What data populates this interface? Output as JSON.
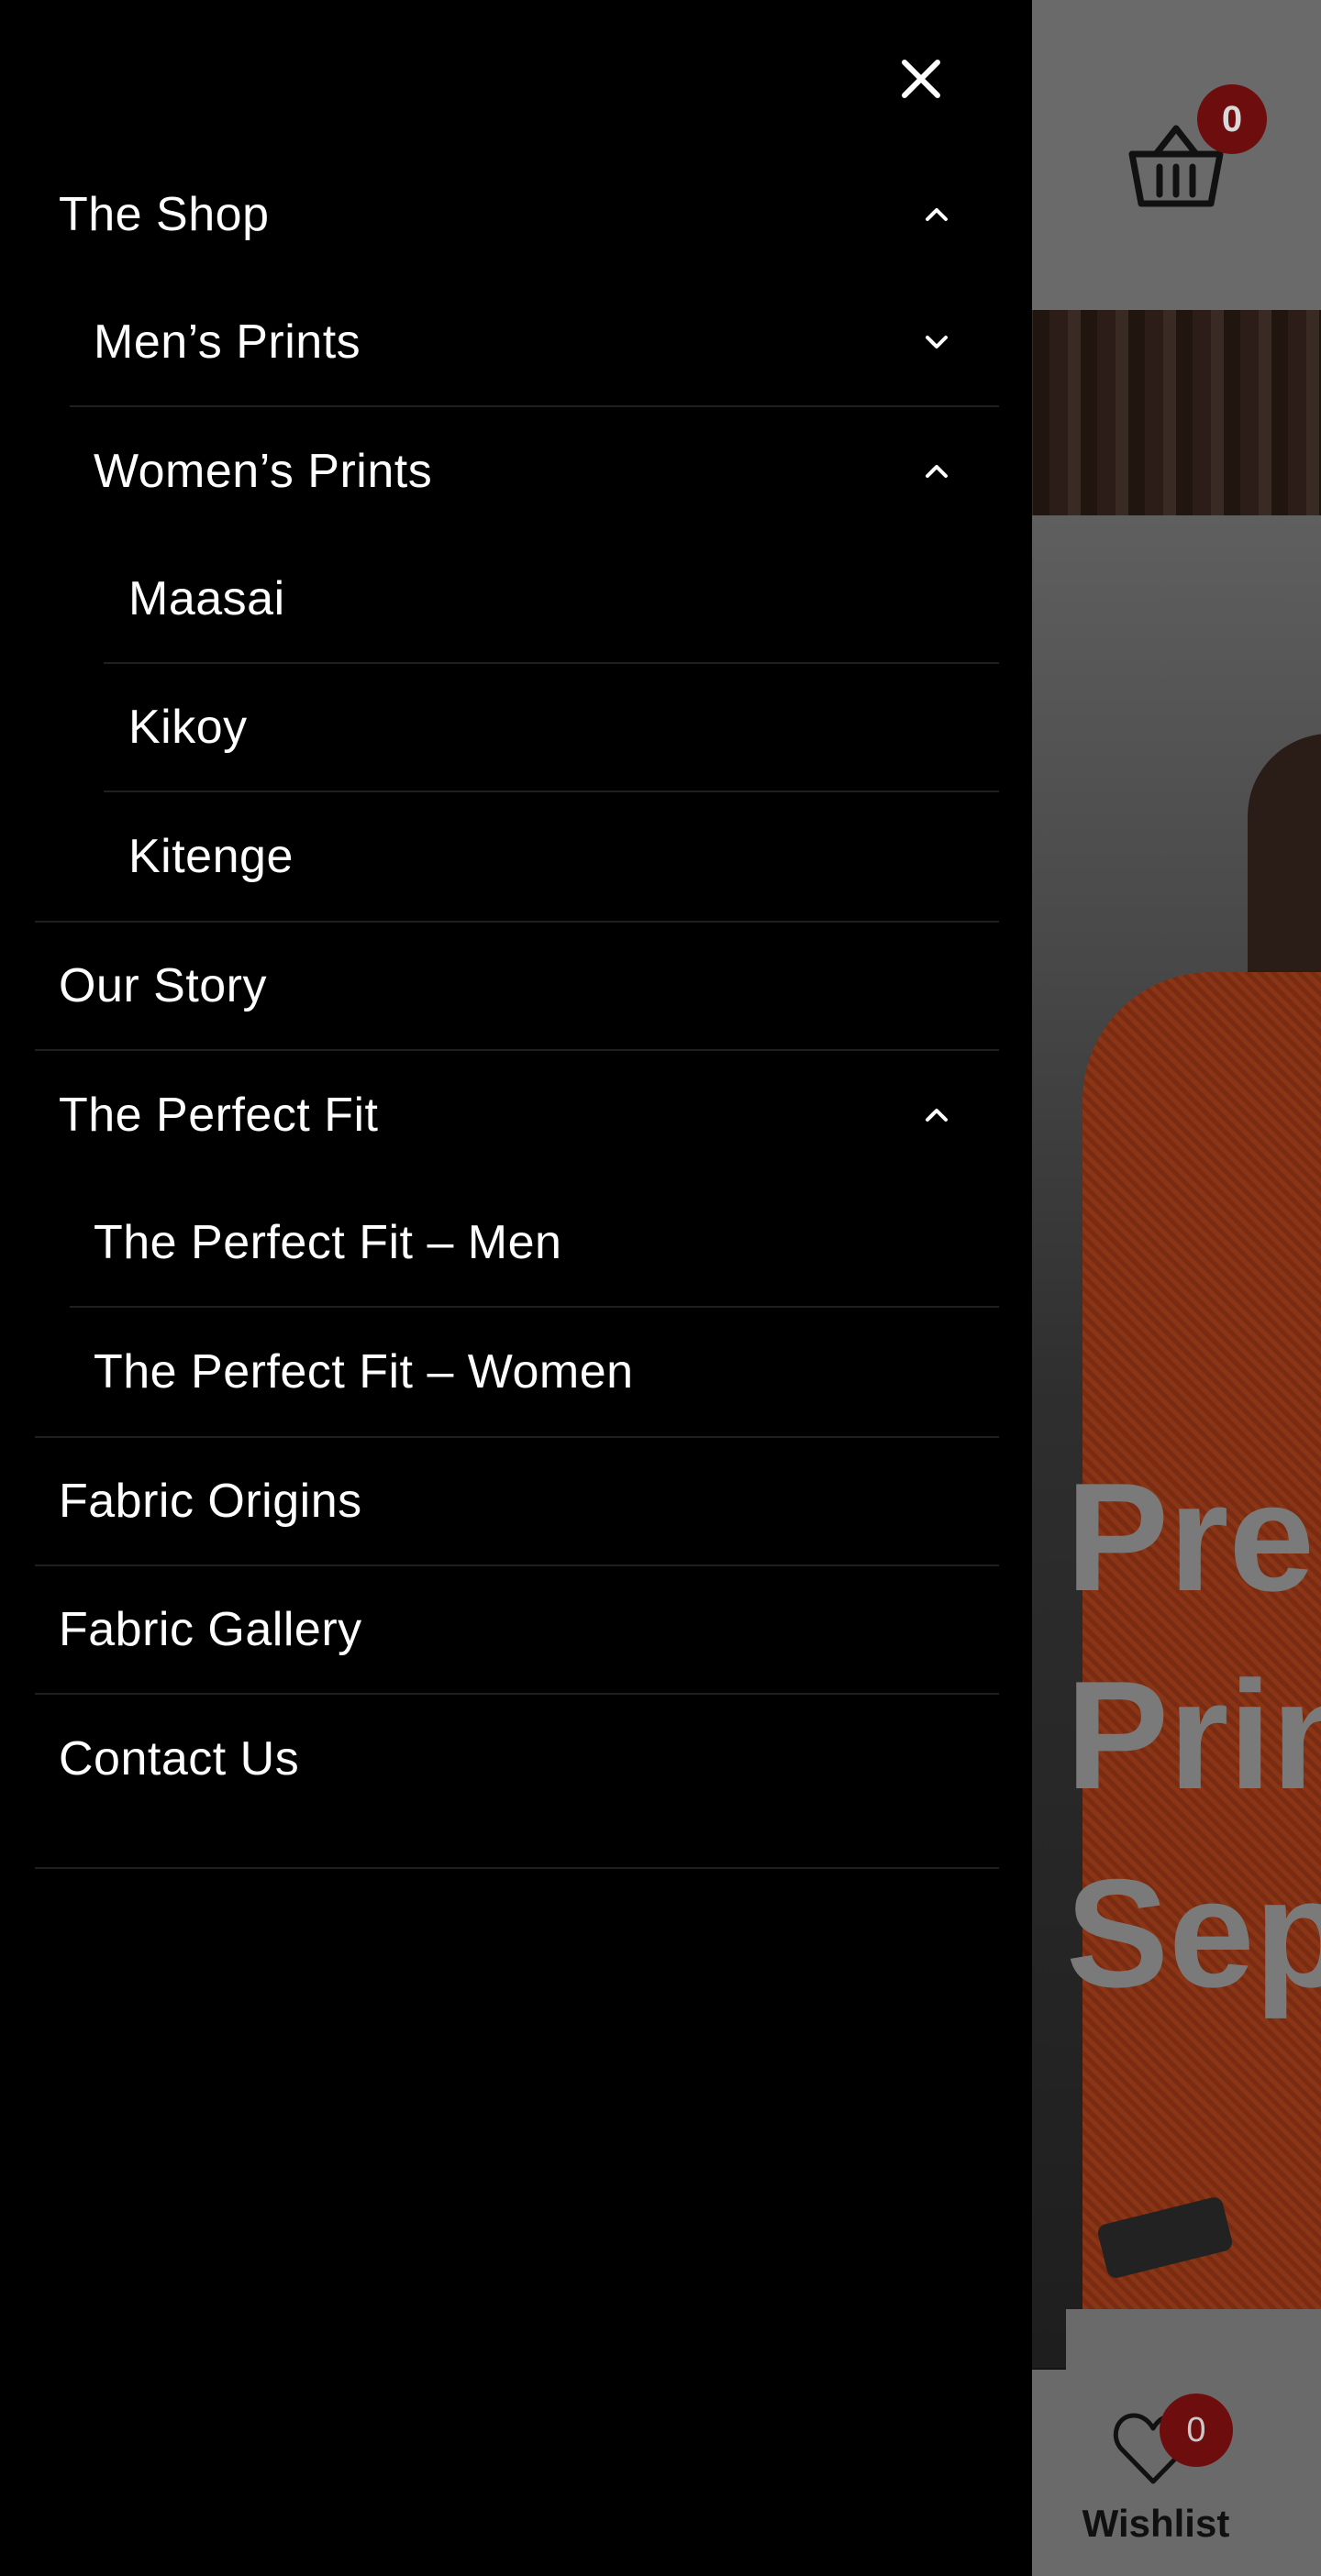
{
  "colors": {
    "drawer_background": "#000000",
    "drawer_text": "#ffffff",
    "divider": "#1f1f1f",
    "badge": "#6d0d0d",
    "overlay_gray": "#6a6a6a"
  },
  "drawer": {
    "close_icon": "close-icon",
    "menu": {
      "the_shop": {
        "label": "The Shop",
        "expanded": true,
        "icon": "chevron-up-icon"
      },
      "mens_prints": {
        "label": "Men’s Prints",
        "expanded": false,
        "icon": "chevron-down-icon"
      },
      "womens_prints": {
        "label": "Women’s Prints",
        "expanded": true,
        "icon": "chevron-up-icon"
      },
      "maasai": {
        "label": "Maasai"
      },
      "kikoy": {
        "label": "Kikoy"
      },
      "kitenge": {
        "label": "Kitenge"
      },
      "our_story": {
        "label": "Our Story"
      },
      "perfect_fit": {
        "label": "The Perfect Fit",
        "expanded": true,
        "icon": "chevron-up-icon"
      },
      "perfect_fit_men": {
        "label": "The Perfect Fit – Men"
      },
      "perfect_fit_women": {
        "label": "The Perfect Fit – Women"
      },
      "fabric_origins": {
        "label": "Fabric Origins"
      },
      "fabric_gallery": {
        "label": "Fabric Gallery"
      },
      "contact_us": {
        "label": "Contact Us"
      }
    }
  },
  "background": {
    "cart": {
      "icon": "basket-icon",
      "count": "0"
    },
    "hero": {
      "headline": "Pren\nPrin\nSep"
    },
    "bottom_bar": {
      "wishlist_label": "Wishlist",
      "wishlist_count": "0",
      "wishlist_icon": "heart-icon"
    }
  }
}
